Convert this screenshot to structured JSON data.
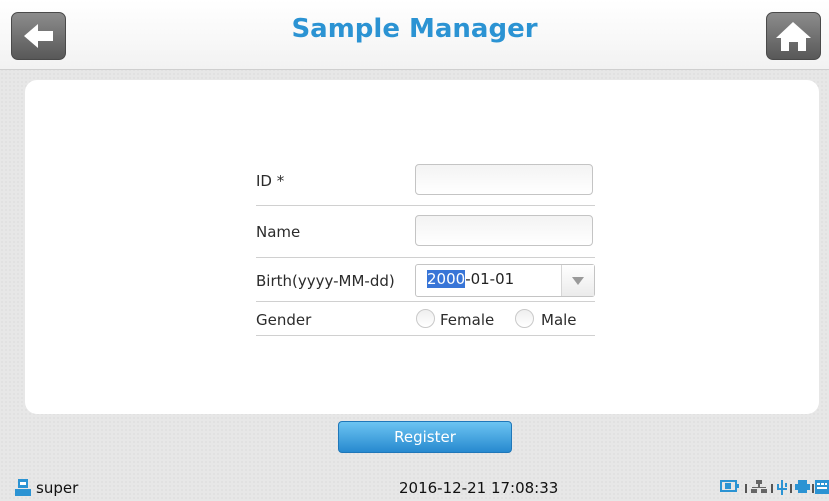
{
  "header": {
    "title": "Sample Manager"
  },
  "form": {
    "id_label": "ID *",
    "id_value": "",
    "name_label": "Name",
    "name_value": "",
    "birth_label": "Birth(yyyy-MM-dd)",
    "birth_year": "2000",
    "birth_rest": "-01-01",
    "gender_label": "Gender",
    "gender_options": [
      "Female",
      "Male"
    ]
  },
  "actions": {
    "register_label": "Register"
  },
  "status_bar": {
    "user": "super",
    "datetime": "2016-12-21 17:08:33",
    "icons": [
      "battery-icon",
      "network-icon",
      "usb-icon",
      "printer-icon",
      "keyboard-icon"
    ]
  },
  "colors": {
    "accent": "#2b93d3",
    "selection": "#3875d7",
    "button": "#2789cf"
  }
}
